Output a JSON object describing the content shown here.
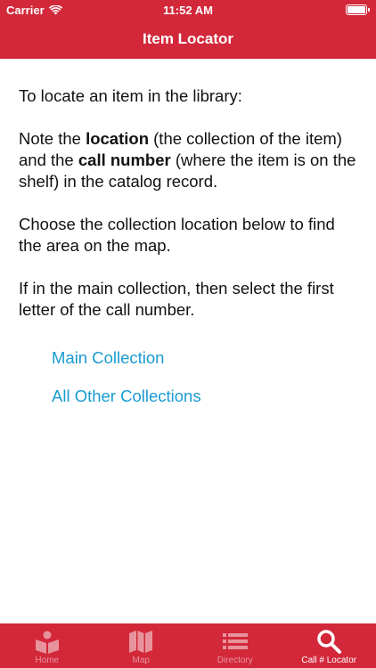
{
  "status_bar": {
    "carrier": "Carrier",
    "time": "11:52 AM"
  },
  "header": {
    "title": "Item Locator"
  },
  "content": {
    "intro": "To locate an item in the library:",
    "p2_a": "Note the ",
    "p2_location": "location",
    "p2_b": " (the collection of the item) and the ",
    "p2_call_number": "call number",
    "p2_c": " (where the item is on the shelf) in the catalog record.",
    "p3": "Choose the collection location below to find the area on the map.",
    "p4": "If in the main collection, then select the first letter of the call number."
  },
  "links": {
    "main": "Main Collection",
    "other": "All Other Collections"
  },
  "tabs": [
    {
      "label": "Home",
      "icon": "book-reader-icon",
      "active": false
    },
    {
      "label": "Map",
      "icon": "map-icon",
      "active": false
    },
    {
      "label": "Directory",
      "icon": "list-icon",
      "active": false
    },
    {
      "label": "Call # Locator",
      "icon": "search-icon",
      "active": true
    }
  ],
  "colors": {
    "brand": "#d2283a",
    "link": "#1a9bd0",
    "tab_inactive": "#e8939c",
    "tab_active": "#ffffff"
  }
}
